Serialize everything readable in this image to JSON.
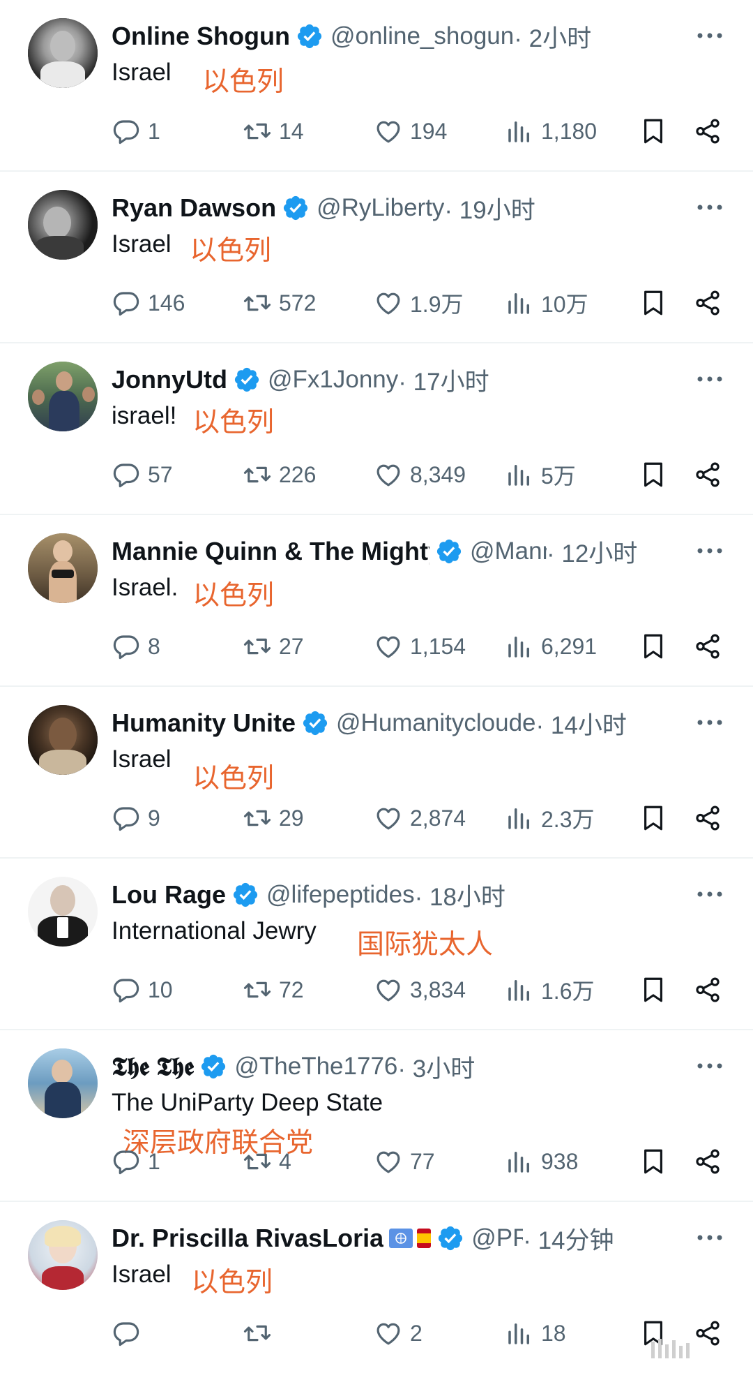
{
  "colors": {
    "verified": "#1d9bf0",
    "muted": "#536471",
    "annotation": "#e8652e"
  },
  "icons": {
    "reply": "reply-icon",
    "retweet": "retweet-icon",
    "like": "heart-icon",
    "views": "views-icon",
    "bookmark": "bookmark-icon",
    "share": "share-icon",
    "more": "more-icon",
    "verified": "verified-badge-icon"
  },
  "tweets": [
    {
      "name": "Online Shogun",
      "handle": "@online_shogun",
      "time": " · 2小时",
      "text": "Israel",
      "translation": "以色列",
      "replies": "1",
      "retweets": "14",
      "likes": "194",
      "views": "1,180"
    },
    {
      "name": "Ryan Dawson",
      "handle": "@RyLiberty",
      "time": " · 19小时",
      "text": "Israel",
      "translation": "以色列",
      "replies": "146",
      "retweets": "572",
      "likes": "1.9万",
      "views": "10万"
    },
    {
      "name": "JonnyUtd",
      "handle": "@Fx1Jonny",
      "time": " · 17小时",
      "text": "israel!",
      "translation": "以色列",
      "replies": "57",
      "retweets": "226",
      "likes": "8,349",
      "views": "5万"
    },
    {
      "name": "Mannie Quinn & The Mighty",
      "handle": "@Mannie",
      "time": " · 12小时",
      "text": "Israel.",
      "translation": "以色列",
      "replies": "8",
      "retweets": "27",
      "likes": "1,154",
      "views": "6,291"
    },
    {
      "name": "Humanity Unite",
      "handle": "@Humanitycloude",
      "time": " · 14小时",
      "text": "Israel",
      "translation": "以色列",
      "replies": "9",
      "retweets": "29",
      "likes": "2,874",
      "views": "2.3万"
    },
    {
      "name": "Lou Rage",
      "handle": "@lifepeptides",
      "time": " · 18小时",
      "text": "International Jewry",
      "translation": "国际犹太人",
      "replies": "10",
      "retweets": "72",
      "likes": "3,834",
      "views": "1.6万"
    },
    {
      "name": "𝕿𝖍𝖊 𝕿𝖍𝖊",
      "handle": "@TheThe1776",
      "time": " · 3小时",
      "text": "The UniParty Deep State",
      "translation": "深层政府联合党",
      "replies": "1",
      "retweets": "4",
      "likes": "77",
      "views": "938"
    },
    {
      "name": "Dr. Priscilla RivasLoria",
      "handle": "@PRL",
      "time": " · 14分钟",
      "text": "Israel",
      "translation": "以色列",
      "replies": "",
      "retweets": "",
      "likes": "2",
      "views": "18"
    }
  ]
}
